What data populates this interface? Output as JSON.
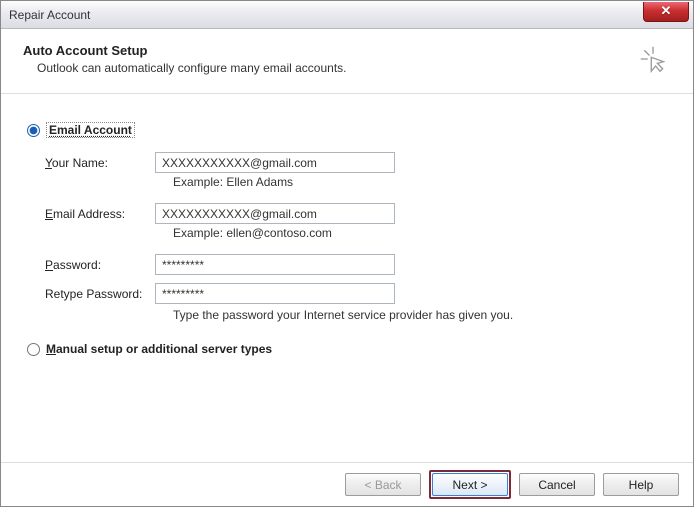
{
  "window": {
    "title": "Repair Account",
    "close_glyph": "✕"
  },
  "header": {
    "title": "Auto Account Setup",
    "subtitle": "Outlook can automatically configure many email accounts."
  },
  "options": {
    "email_account_label": "Email Account",
    "manual_label_prefix": "M",
    "manual_label_rest": "anual setup or additional server types"
  },
  "form": {
    "your_name": {
      "label_ul": "Y",
      "label_rest": "our Name:",
      "value": "XXXXXXXXXXX@gmail.com",
      "example": "Example: Ellen Adams"
    },
    "email": {
      "label_ul": "E",
      "label_rest": "mail Address:",
      "value": "XXXXXXXXXXX@gmail.com",
      "example": "Example: ellen@contoso.com"
    },
    "password": {
      "label_ul": "P",
      "label_rest": "assword:",
      "value": "*********"
    },
    "retype": {
      "label": "Retype Password:",
      "value": "*********"
    },
    "hint": "Type the password your Internet service provider has given you."
  },
  "buttons": {
    "back": "< Back",
    "next": "Next >",
    "cancel": "Cancel",
    "help": "Help"
  }
}
